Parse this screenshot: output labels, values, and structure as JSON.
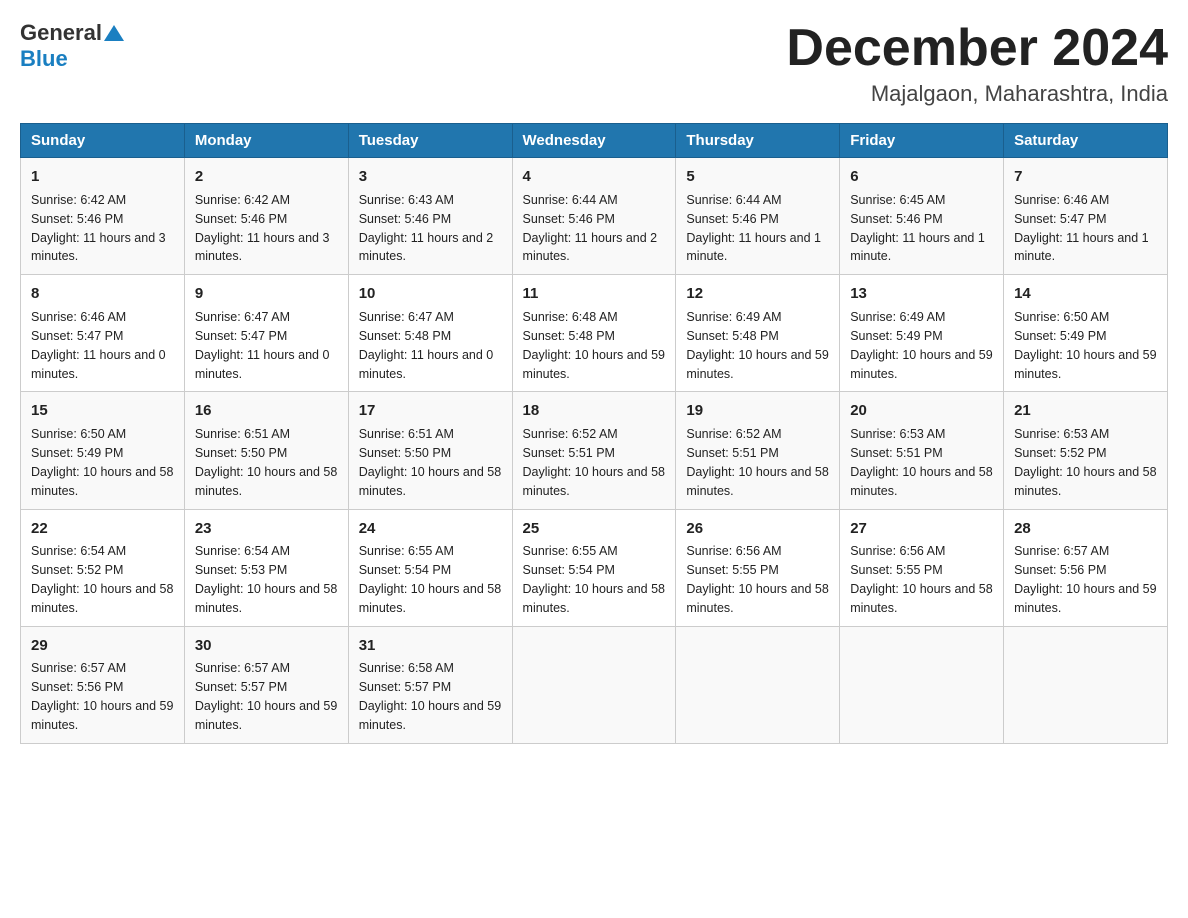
{
  "header": {
    "logo_general": "General",
    "logo_blue": "Blue",
    "month": "December 2024",
    "location": "Majalgaon, Maharashtra, India"
  },
  "days_of_week": [
    "Sunday",
    "Monday",
    "Tuesday",
    "Wednesday",
    "Thursday",
    "Friday",
    "Saturday"
  ],
  "weeks": [
    [
      {
        "day": "1",
        "sunrise": "6:42 AM",
        "sunset": "5:46 PM",
        "daylight": "11 hours and 3 minutes."
      },
      {
        "day": "2",
        "sunrise": "6:42 AM",
        "sunset": "5:46 PM",
        "daylight": "11 hours and 3 minutes."
      },
      {
        "day": "3",
        "sunrise": "6:43 AM",
        "sunset": "5:46 PM",
        "daylight": "11 hours and 2 minutes."
      },
      {
        "day": "4",
        "sunrise": "6:44 AM",
        "sunset": "5:46 PM",
        "daylight": "11 hours and 2 minutes."
      },
      {
        "day": "5",
        "sunrise": "6:44 AM",
        "sunset": "5:46 PM",
        "daylight": "11 hours and 1 minute."
      },
      {
        "day": "6",
        "sunrise": "6:45 AM",
        "sunset": "5:46 PM",
        "daylight": "11 hours and 1 minute."
      },
      {
        "day": "7",
        "sunrise": "6:46 AM",
        "sunset": "5:47 PM",
        "daylight": "11 hours and 1 minute."
      }
    ],
    [
      {
        "day": "8",
        "sunrise": "6:46 AM",
        "sunset": "5:47 PM",
        "daylight": "11 hours and 0 minutes."
      },
      {
        "day": "9",
        "sunrise": "6:47 AM",
        "sunset": "5:47 PM",
        "daylight": "11 hours and 0 minutes."
      },
      {
        "day": "10",
        "sunrise": "6:47 AM",
        "sunset": "5:48 PM",
        "daylight": "11 hours and 0 minutes."
      },
      {
        "day": "11",
        "sunrise": "6:48 AM",
        "sunset": "5:48 PM",
        "daylight": "10 hours and 59 minutes."
      },
      {
        "day": "12",
        "sunrise": "6:49 AM",
        "sunset": "5:48 PM",
        "daylight": "10 hours and 59 minutes."
      },
      {
        "day": "13",
        "sunrise": "6:49 AM",
        "sunset": "5:49 PM",
        "daylight": "10 hours and 59 minutes."
      },
      {
        "day": "14",
        "sunrise": "6:50 AM",
        "sunset": "5:49 PM",
        "daylight": "10 hours and 59 minutes."
      }
    ],
    [
      {
        "day": "15",
        "sunrise": "6:50 AM",
        "sunset": "5:49 PM",
        "daylight": "10 hours and 58 minutes."
      },
      {
        "day": "16",
        "sunrise": "6:51 AM",
        "sunset": "5:50 PM",
        "daylight": "10 hours and 58 minutes."
      },
      {
        "day": "17",
        "sunrise": "6:51 AM",
        "sunset": "5:50 PM",
        "daylight": "10 hours and 58 minutes."
      },
      {
        "day": "18",
        "sunrise": "6:52 AM",
        "sunset": "5:51 PM",
        "daylight": "10 hours and 58 minutes."
      },
      {
        "day": "19",
        "sunrise": "6:52 AM",
        "sunset": "5:51 PM",
        "daylight": "10 hours and 58 minutes."
      },
      {
        "day": "20",
        "sunrise": "6:53 AM",
        "sunset": "5:51 PM",
        "daylight": "10 hours and 58 minutes."
      },
      {
        "day": "21",
        "sunrise": "6:53 AM",
        "sunset": "5:52 PM",
        "daylight": "10 hours and 58 minutes."
      }
    ],
    [
      {
        "day": "22",
        "sunrise": "6:54 AM",
        "sunset": "5:52 PM",
        "daylight": "10 hours and 58 minutes."
      },
      {
        "day": "23",
        "sunrise": "6:54 AM",
        "sunset": "5:53 PM",
        "daylight": "10 hours and 58 minutes."
      },
      {
        "day": "24",
        "sunrise": "6:55 AM",
        "sunset": "5:54 PM",
        "daylight": "10 hours and 58 minutes."
      },
      {
        "day": "25",
        "sunrise": "6:55 AM",
        "sunset": "5:54 PM",
        "daylight": "10 hours and 58 minutes."
      },
      {
        "day": "26",
        "sunrise": "6:56 AM",
        "sunset": "5:55 PM",
        "daylight": "10 hours and 58 minutes."
      },
      {
        "day": "27",
        "sunrise": "6:56 AM",
        "sunset": "5:55 PM",
        "daylight": "10 hours and 58 minutes."
      },
      {
        "day": "28",
        "sunrise": "6:57 AM",
        "sunset": "5:56 PM",
        "daylight": "10 hours and 59 minutes."
      }
    ],
    [
      {
        "day": "29",
        "sunrise": "6:57 AM",
        "sunset": "5:56 PM",
        "daylight": "10 hours and 59 minutes."
      },
      {
        "day": "30",
        "sunrise": "6:57 AM",
        "sunset": "5:57 PM",
        "daylight": "10 hours and 59 minutes."
      },
      {
        "day": "31",
        "sunrise": "6:58 AM",
        "sunset": "5:57 PM",
        "daylight": "10 hours and 59 minutes."
      },
      {
        "day": "",
        "sunrise": "",
        "sunset": "",
        "daylight": ""
      },
      {
        "day": "",
        "sunrise": "",
        "sunset": "",
        "daylight": ""
      },
      {
        "day": "",
        "sunrise": "",
        "sunset": "",
        "daylight": ""
      },
      {
        "day": "",
        "sunrise": "",
        "sunset": "",
        "daylight": ""
      }
    ]
  ]
}
